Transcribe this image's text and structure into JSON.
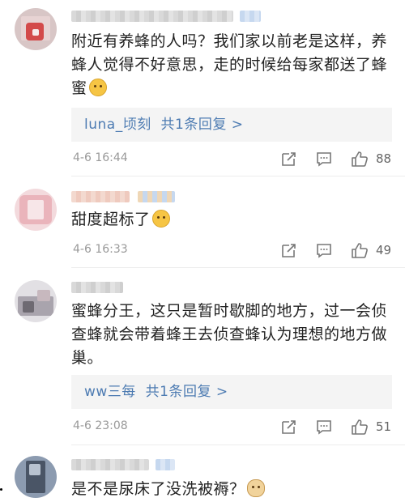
{
  "comments": [
    {
      "text": "附近有养蜂的人吗？我们家以前老是这样，养蜂人觉得不好意思，走的时候给每家都送了蜂蜜",
      "emoji": "laughing-tears-emoji",
      "reply": {
        "user": "luna_顷刻",
        "summary": "共1条回复 >"
      },
      "time": "4-6 16:44",
      "likes": "88",
      "avatar_colors": [
        "#c9a7a7",
        "#d34a4a",
        "#9a9a9a"
      ]
    },
    {
      "text": "甜度超标了",
      "emoji": "thinking-emoji",
      "time": "4-6 16:33",
      "likes": "49",
      "avatar_colors": [
        "#f0c4c8",
        "#e6a0a8",
        "#f5dede"
      ]
    },
    {
      "text": "蜜蜂分王，这只是暂时歇脚的地方，过一会侦查蜂就会带着蜂王去侦查蜂认为理想的地方做巢。",
      "reply": {
        "user": "ww三每",
        "summary": "共1条回复 >"
      },
      "time": "4-6 23:08",
      "likes": "51",
      "avatar_colors": [
        "#8a8a8a",
        "#c9c3cc",
        "#b7a9ad"
      ]
    },
    {
      "text": "是不是尿床了没洗被褥？",
      "emoji": "doge-emoji",
      "avatar_colors": [
        "#5f6f85",
        "#8c9bb0",
        "#3b4454"
      ]
    }
  ],
  "icons": {
    "share": "share-icon",
    "comment": "comment-icon",
    "like": "thumbs-up-icon"
  },
  "colors": {
    "link": "#4d7bb2",
    "meta": "#999999",
    "reply_bg": "#f4f4f4"
  }
}
